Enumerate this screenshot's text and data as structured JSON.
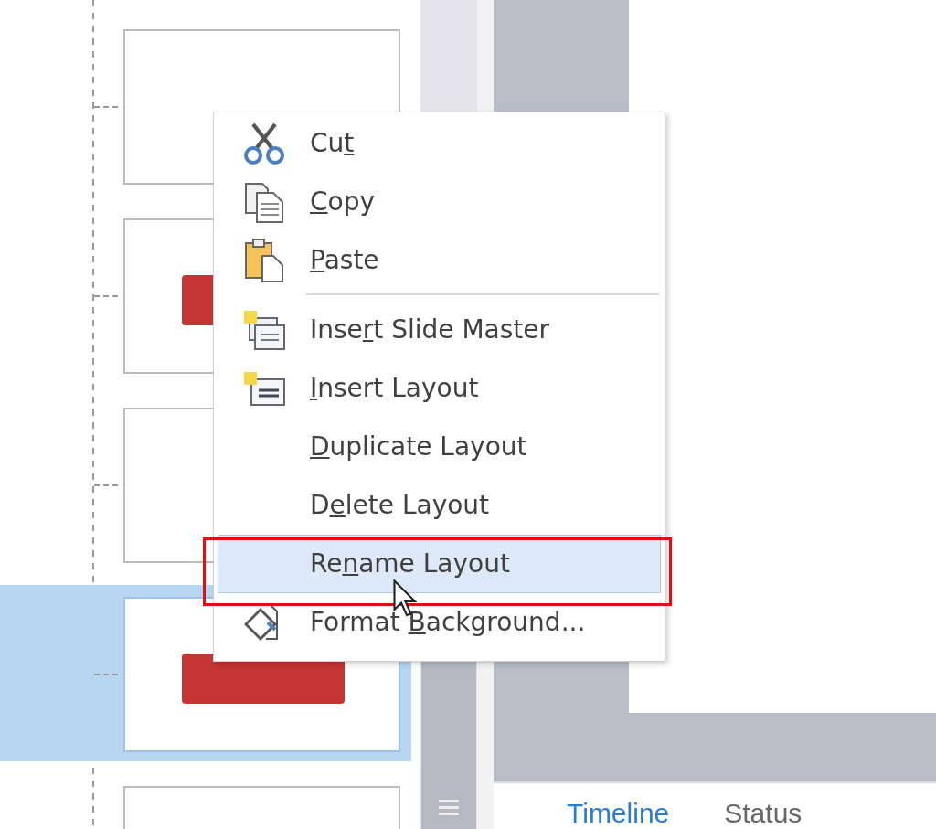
{
  "thumbnails": [
    {
      "kind": "blank",
      "selected": false
    },
    {
      "kind": "titled",
      "selected": false
    },
    {
      "kind": "blank",
      "selected": false
    },
    {
      "kind": "titled",
      "selected": true
    },
    {
      "kind": "blank",
      "selected": false
    }
  ],
  "context_menu": {
    "items": [
      {
        "kind": "item",
        "pre": "Cu",
        "key": "t",
        "selected": false
      },
      {
        "kind": "item",
        "key": "C",
        "post": "opy",
        "selected": false
      },
      {
        "kind": "item",
        "key": "P",
        "post": "aste",
        "selected": false
      },
      {
        "kind": "separator"
      },
      {
        "kind": "item",
        "pre": "Inse",
        "key": "r",
        "post": "t Slide Master",
        "selected": false
      },
      {
        "kind": "item",
        "key": "I",
        "post": "nsert Layout",
        "selected": false
      },
      {
        "kind": "item",
        "key": "D",
        "post": "uplicate Layout",
        "selected": false
      },
      {
        "kind": "item",
        "pre": "D",
        "key": "e",
        "post": "lete Layout",
        "selected": false
      },
      {
        "kind": "item",
        "pre": "Re",
        "key": "n",
        "post": "ame Layout",
        "selected": true
      },
      {
        "kind": "item",
        "pre": "Format ",
        "key": "B",
        "post": "ackground...",
        "selected": false
      }
    ]
  },
  "bottom_panel": {
    "tabs": [
      {
        "label": "Timeline",
        "selected": true
      },
      {
        "label": "Status",
        "selected": false
      }
    ]
  }
}
